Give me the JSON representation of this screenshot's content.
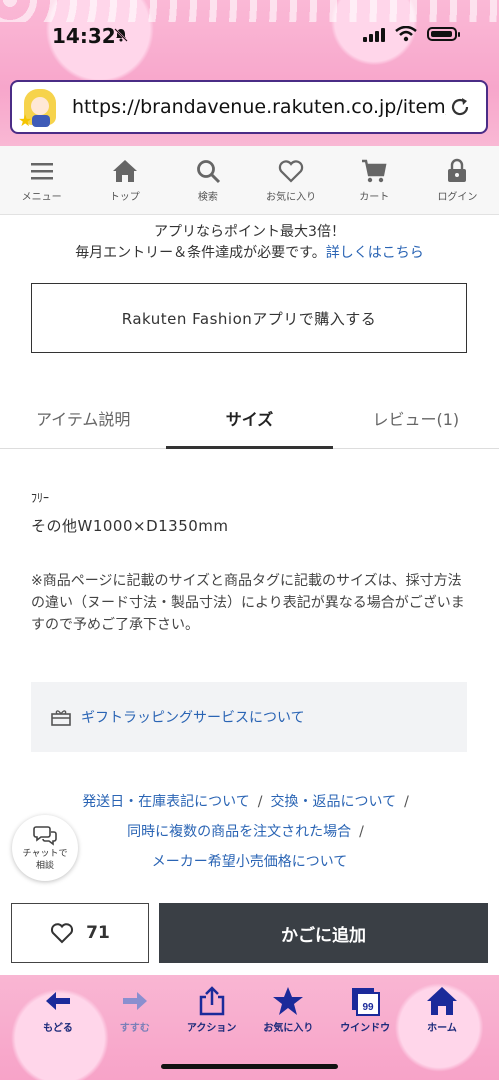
{
  "status": {
    "time": "14:32"
  },
  "browser": {
    "url": "https://brandavenue.rakuten.co.jp/item/C..."
  },
  "nav": {
    "items": [
      {
        "label": "メニュー",
        "icon": "menu-icon"
      },
      {
        "label": "トップ",
        "icon": "home-icon"
      },
      {
        "label": "検索",
        "icon": "search-icon"
      },
      {
        "label": "お気に入り",
        "icon": "heart-icon"
      },
      {
        "label": "カート",
        "icon": "cart-icon"
      },
      {
        "label": "ログイン",
        "icon": "lock-icon"
      }
    ]
  },
  "promo": {
    "line1": "アプリならポイント最大3倍！",
    "line2_text": "毎月エントリー＆条件達成が必要です。",
    "line2_link": "詳しくはこちら"
  },
  "app_button": {
    "label": "Rakuten Fashionアプリで購入する"
  },
  "tabs": [
    {
      "label": "アイテム説明",
      "active": false
    },
    {
      "label": "サイズ",
      "active": true
    },
    {
      "label": "レビュー(1)",
      "active": false
    }
  ],
  "size": {
    "label": "ﾌﾘｰ",
    "value": "その他W1000×D1350mm",
    "note": "※商品ページに記載のサイズと商品タグに記載のサイズは、採寸方法の違い（ヌード寸法・製品寸法）により表記が異なる場合がございますので予めご了承下さい。"
  },
  "gift": {
    "label": "ギフトラッピングサービスについて"
  },
  "links": {
    "shipping": "発送日・在庫表記について",
    "returns": "交換・返品について",
    "multiple": "同時に複数の商品を注文された場合",
    "price": "メーカー希望小売価格について",
    "separator": "/"
  },
  "chat": {
    "line1": "チャットで",
    "line2": "相談"
  },
  "actions": {
    "favorite_count": "71",
    "add_to_cart": "かごに追加"
  },
  "toolbar": [
    {
      "label": "もどる",
      "icon": "back-arrow-icon",
      "enabled": true
    },
    {
      "label": "すすむ",
      "icon": "forward-arrow-icon",
      "enabled": false
    },
    {
      "label": "アクション",
      "icon": "share-icon",
      "enabled": true
    },
    {
      "label": "お気に入り",
      "icon": "star-icon",
      "enabled": true
    },
    {
      "label": "ウインドウ",
      "icon": "windows-icon",
      "enabled": true
    },
    {
      "label": "ホーム",
      "icon": "home-icon",
      "enabled": true
    }
  ],
  "window_count": "99",
  "colors": {
    "link": "#2a64b4",
    "cart_button": "#3a3f45",
    "toolbar_text": "#1b2a7a",
    "header_pink": "#f7a6cb"
  }
}
